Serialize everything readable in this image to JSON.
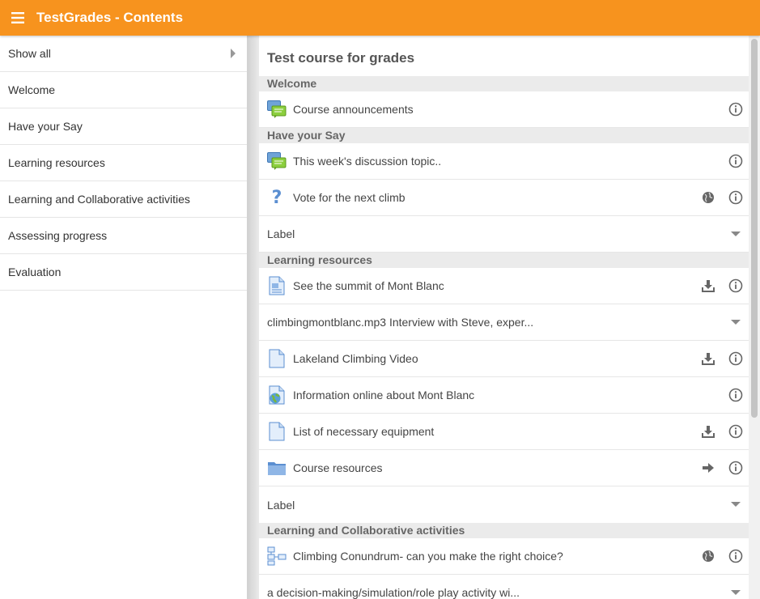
{
  "app": {
    "title": "TestGrades - Contents",
    "accent_color": "#f7931e"
  },
  "sidebar": {
    "items": [
      {
        "label": "Show all",
        "icon": "chevron-right-icon"
      },
      {
        "label": "Welcome"
      },
      {
        "label": "Have your Say"
      },
      {
        "label": "Learning resources"
      },
      {
        "label": "Learning and Collaborative activities"
      },
      {
        "label": "Assessing progress"
      },
      {
        "label": "Evaluation"
      }
    ]
  },
  "main": {
    "course_title": "Test course for grades",
    "sections": [
      {
        "name": "Welcome",
        "items": [
          {
            "label": "Course announcements",
            "icon": "forum-icon",
            "actions": [
              "info-icon"
            ]
          }
        ]
      },
      {
        "name": "Have your Say",
        "items": [
          {
            "label": "This week's discussion topic..",
            "icon": "forum-icon",
            "actions": [
              "info-icon"
            ]
          },
          {
            "label": "Vote for the next climb",
            "icon": "question-icon",
            "actions": [
              "globe-icon",
              "info-icon"
            ]
          },
          {
            "label": "Label",
            "actions": [
              "expand-icon"
            ]
          }
        ]
      },
      {
        "name": "Learning resources",
        "items": [
          {
            "label": "See the summit of Mont Blanc",
            "icon": "page-icon",
            "actions": [
              "download-icon",
              "info-icon"
            ]
          },
          {
            "label": "climbingmontblanc.mp3 Interview with Steve, exper...",
            "actions": [
              "expand-icon"
            ]
          },
          {
            "label": "Lakeland Climbing Video",
            "icon": "file-icon",
            "actions": [
              "download-icon",
              "info-icon"
            ]
          },
          {
            "label": "Information online about Mont Blanc",
            "icon": "url-icon",
            "actions": [
              "info-icon"
            ]
          },
          {
            "label": "List of necessary equipment",
            "icon": "file-icon",
            "actions": [
              "download-icon",
              "info-icon"
            ]
          },
          {
            "label": "Course resources",
            "icon": "folder-icon",
            "actions": [
              "arrow-right-icon",
              "info-icon"
            ]
          },
          {
            "label": "Label",
            "actions": [
              "expand-icon"
            ]
          }
        ]
      },
      {
        "name": "Learning and Collaborative activities",
        "items": [
          {
            "label": "Climbing Conundrum- can you make the right choice?",
            "icon": "lesson-icon",
            "actions": [
              "globe-icon",
              "info-icon"
            ]
          },
          {
            "label": "a decision-making/simulation/role play activity wi...",
            "actions": [
              "expand-icon"
            ]
          }
        ]
      }
    ]
  }
}
